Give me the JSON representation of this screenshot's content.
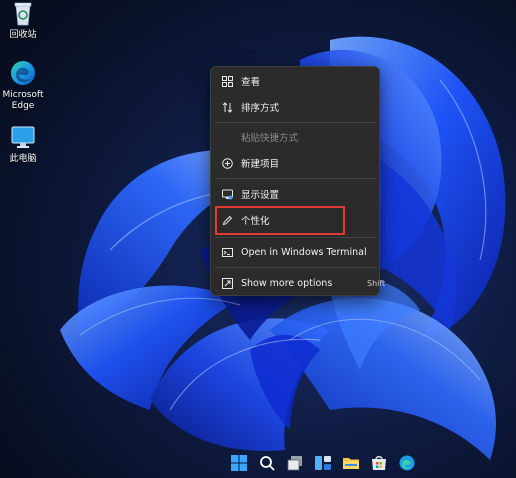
{
  "desktop": {
    "icons": [
      {
        "label": "回收站",
        "icon": "recycle-bin-icon"
      },
      {
        "label": "Microsoft\nEdge",
        "icon": "edge-icon"
      },
      {
        "label": "此电脑",
        "icon": "this-pc-icon"
      }
    ]
  },
  "context_menu": {
    "items": [
      {
        "label": "查看",
        "icon": "view-grid-icon",
        "enabled": true
      },
      {
        "label": "排序方式",
        "icon": "sort-arrows-icon",
        "enabled": true
      },
      {
        "label": "粘贴快捷方式",
        "icon": "",
        "enabled": false
      },
      {
        "label": "新建项目",
        "icon": "plus-circle-icon",
        "enabled": true
      },
      {
        "label": "显示设置",
        "icon": "display-settings-icon",
        "enabled": true
      },
      {
        "label": "个性化",
        "icon": "pen-icon",
        "enabled": true,
        "highlighted": true
      },
      {
        "label": "Open in Windows Terminal",
        "icon": "terminal-icon",
        "enabled": true
      },
      {
        "label": "Show more options",
        "icon": "more-options-icon",
        "enabled": true,
        "shortcut": "Shift"
      }
    ],
    "highlight_color": "#e23b32"
  },
  "taskbar": {
    "icons": [
      "start-icon",
      "search-icon",
      "task-view-icon",
      "widgets-icon",
      "file-explorer-icon",
      "store-icon",
      "edge-icon"
    ]
  },
  "colors": {
    "menu_bg": "#2b2b2b",
    "wallpaper_bg": "#0b1326",
    "bloom_blue": "#1e5bff"
  }
}
